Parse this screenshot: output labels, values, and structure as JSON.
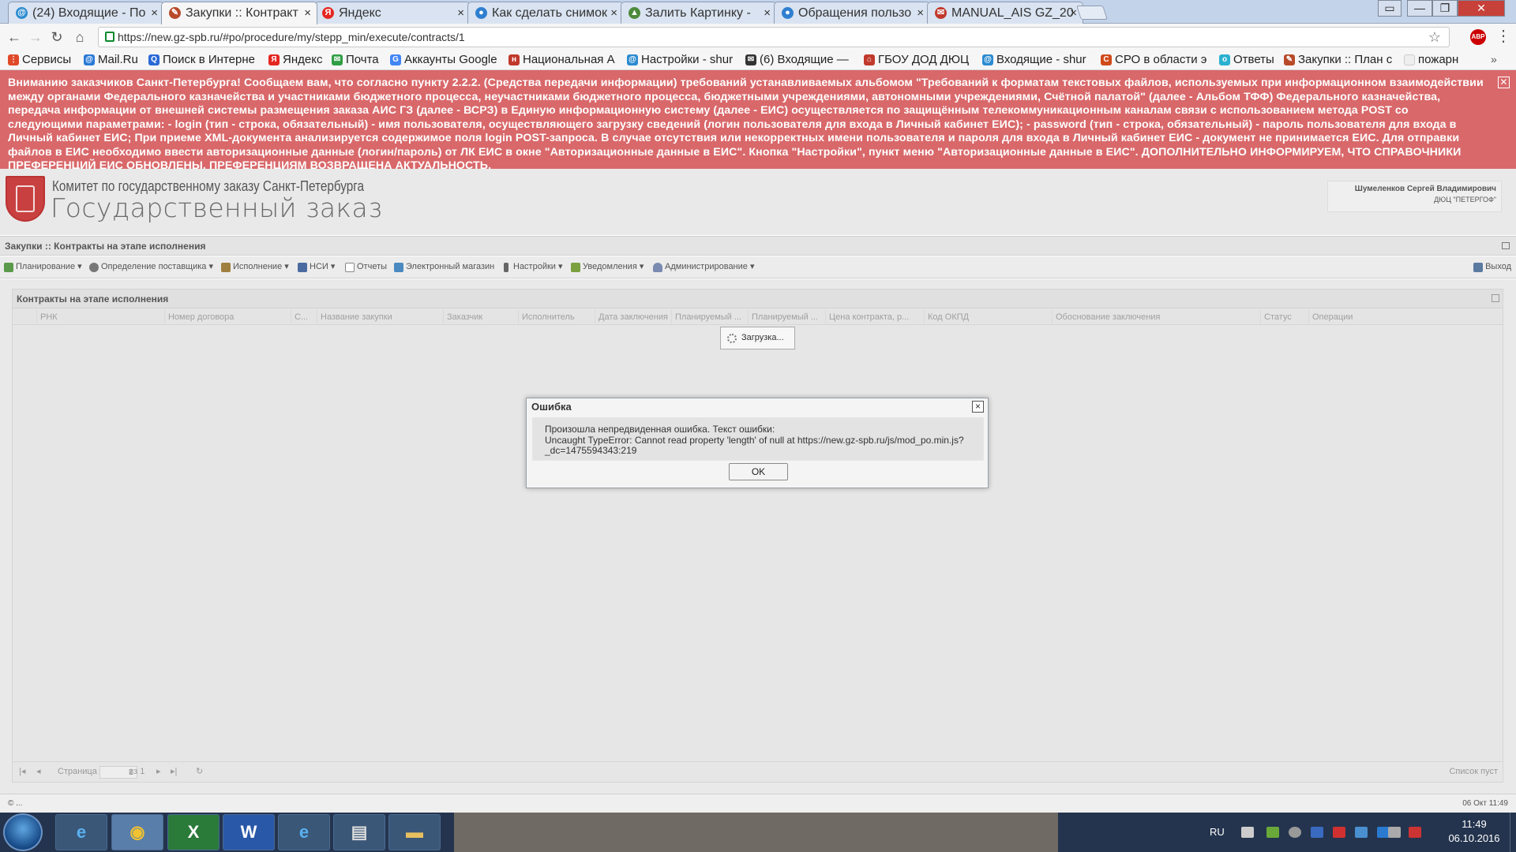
{
  "browser": {
    "tabs": [
      {
        "label": "(24) Входящие - По",
        "icon": "at-icon",
        "color": "#2b8bd0"
      },
      {
        "label": "Закупки :: Контракт",
        "icon": "tool-icon",
        "color": "#b84a2a"
      },
      {
        "label": "Яндекс",
        "icon": "yandex-icon",
        "color": "#e52620"
      },
      {
        "label": "Как сделать снимок",
        "icon": "globe-icon",
        "color": "#2f7fcf"
      },
      {
        "label": "Залить Картинку - ",
        "icon": "image-icon",
        "color": "#4c8a3a"
      },
      {
        "label": "Обращения пользо",
        "icon": "globe-icon",
        "color": "#2f7fcf"
      },
      {
        "label": "MANUAL_AIS GZ_20",
        "icon": "doc-icon",
        "color": "#c0392b"
      }
    ],
    "url": "https://new.gz-spb.ru/#po/procedure/my/stepp_min/execute/contracts/1",
    "abp_label": "ABP",
    "bookmarks": [
      {
        "label": "Сервисы",
        "icon": "apps-icon",
        "color": "#e04a2a"
      },
      {
        "label": "Mail.Ru",
        "icon": "mailru-icon",
        "color": "#2a7ad6"
      },
      {
        "label": "Поиск в Интерне",
        "icon": "search-icon",
        "color": "#2a6ad6"
      },
      {
        "label": "Яндекс",
        "icon": "yandex-icon",
        "color": "#e52620"
      },
      {
        "label": "Почта",
        "icon": "mail-icon",
        "color": "#2f9e44"
      },
      {
        "label": "Аккаунты Google",
        "icon": "google-icon",
        "color": "#4285f4"
      },
      {
        "label": "Национальная А",
        "icon": "bookmark-icon",
        "color": "#c0392b"
      },
      {
        "label": "Настройки - shur",
        "icon": "at-icon",
        "color": "#2b8bd0"
      },
      {
        "label": "(6) Входящие — ",
        "icon": "envelope-icon",
        "color": "#333333"
      },
      {
        "label": "ГБОУ ДОД ДЮЦ ",
        "icon": "home-icon",
        "color": "#c0392b"
      },
      {
        "label": "Входящие - shur",
        "icon": "at-icon",
        "color": "#2b8bd0"
      },
      {
        "label": "СРО в области э",
        "icon": "cpo-icon",
        "color": "#d04a1a"
      },
      {
        "label": "Ответы",
        "icon": "answers-icon",
        "color": "#2ab0d0"
      },
      {
        "label": "Закупки :: План с",
        "icon": "tool-icon",
        "color": "#b84a2a"
      },
      {
        "label": "пожарн",
        "icon": "page-icon",
        "color": "#dddddd"
      }
    ],
    "bookmarks_more": "»"
  },
  "notice": {
    "text": "Вниманию заказчиков Санкт-Петербурга! Сообщаем вам, что согласно пункту 2.2.2. (Средства передачи информации) требований устанавливаемых альбомом \"Требований к форматам текстовых файлов, используемых при информационном взаимодействии между органами Федерального казначейства и участниками бюджетного процесса, неучастниками бюджетного процесса, бюджетными учреждениями, автономными учреждениями, Счётной палатой\" (далее - Альбом ТФФ) Федерального казначейства, передача информации от внешней системы размещения заказа АИС ГЗ (далее - ВСРЗ) в Единую информационную систему (далее - ЕИС) осуществляется по защищённым телекоммуникационным каналам связи с использованием метода POST со следующими параметрами: - login (тип - строка, обязательный) - имя пользователя, осуществляющего загрузку сведений (логин пользователя для входа в Личный кабинет ЕИС); - password (тип - строка, обязательный) - пароль пользователя для входа в Личный кабинет ЕИС; При приеме XML-документа анализируется содержимое поля login POST-запроса. В случае отсутствия или некорректных имени пользователя и пароля для входа в Личный кабинет ЕИС - документ не принимается ЕИС. Для отправки файлов в ЕИС необходимо ввести авторизационные данные (логин/пароль) от ЛК ЕИС в окне \"Авторизационные данные в ЕИС\". Кнопка \"Настройки\", пункт меню \"Авторизационные данные в ЕИС\". ДОПОЛНИТЕЛЬНО ИНФОРМИРУЕМ, ЧТО СПРАВОЧНИКИ ПРЕФЕРЕНЦИЙ ЕИС ОБНОВЛЕНЫ, ПРЕФЕРЕНЦИЯМ ВОЗВРАЩЕНА АКТУАЛЬНОСТЬ.",
    "close": "✕"
  },
  "app": {
    "org_line1": "Комитет по государственному заказу Санкт-Петербурга",
    "org_line2": "Государственный заказ",
    "user_name": "Шумеленков Сергей Владимирович",
    "user_org": "ДЮЦ \"ПЕТЕРГОФ\"",
    "breadcrumb": "Закупки :: Контракты на этапе исполнения",
    "menu": [
      {
        "label": "Планирование ▾",
        "icon": "planning-icon",
        "color": "#5a9a4a"
      },
      {
        "label": "Определение поставщика ▾",
        "icon": "gears-icon",
        "color": "#777777"
      },
      {
        "label": "Исполнение ▾",
        "icon": "execution-icon",
        "color": "#a08040"
      },
      {
        "label": "НСИ ▾",
        "icon": "table-icon",
        "color": "#4a6aa0"
      },
      {
        "label": "Отчеты",
        "icon": "report-icon",
        "color": "#888888"
      },
      {
        "label": "Электронный магазин",
        "icon": "cart-icon",
        "color": "#4a8ac0"
      },
      {
        "label": "Настройки ▾",
        "icon": "wrench-icon",
        "color": "#666666"
      },
      {
        "label": "Уведомления ▾",
        "icon": "notify-icon",
        "color": "#7aa040"
      },
      {
        "label": "Администрирование ▾",
        "icon": "admin-icon",
        "color": "#7a8ab0"
      }
    ],
    "exit_label": "Выход"
  },
  "panel": {
    "title": "Контракты на этапе исполнения",
    "columns": [
      "РНК",
      "Номер договора",
      "С...",
      "Название закупки",
      "Заказчик",
      "Исполнитель",
      "Дата заключения",
      "Планируемый ...",
      "Планируемый ...",
      "Цена контракта, р...",
      "Код ОКПД",
      "Обоснование заключения",
      "Статус",
      "Операции"
    ],
    "loading": "Загрузка...",
    "pager": {
      "page_label": "Страница",
      "page_value": "1",
      "of_label": "из 1",
      "empty": "Список пуст"
    }
  },
  "status": {
    "left": "© ...",
    "right": "06 Окт 11:49"
  },
  "dialog": {
    "title": "Ошибка",
    "line1": "Произошла непредвиденная ошибка. Текст ошибки:",
    "line2": "Uncaught TypeError: Cannot read property 'length' of null at https://new.gz-spb.ru/js/mod_po.min.js?",
    "line3": "_dc=1475594343:219",
    "ok": "OK"
  },
  "taskbar": {
    "apps": [
      {
        "label": "e",
        "icon": "ie-icon"
      },
      {
        "label": "◉",
        "icon": "chrome-icon"
      },
      {
        "label": "X",
        "icon": "excel-icon"
      },
      {
        "label": "W",
        "icon": "word-icon"
      },
      {
        "label": "e",
        "icon": "ie-icon"
      },
      {
        "label": "▤",
        "icon": "scanner-icon"
      },
      {
        "label": "▬",
        "icon": "folder-icon"
      }
    ],
    "lang": "RU",
    "time": "11:49",
    "date": "06.10.2016"
  }
}
